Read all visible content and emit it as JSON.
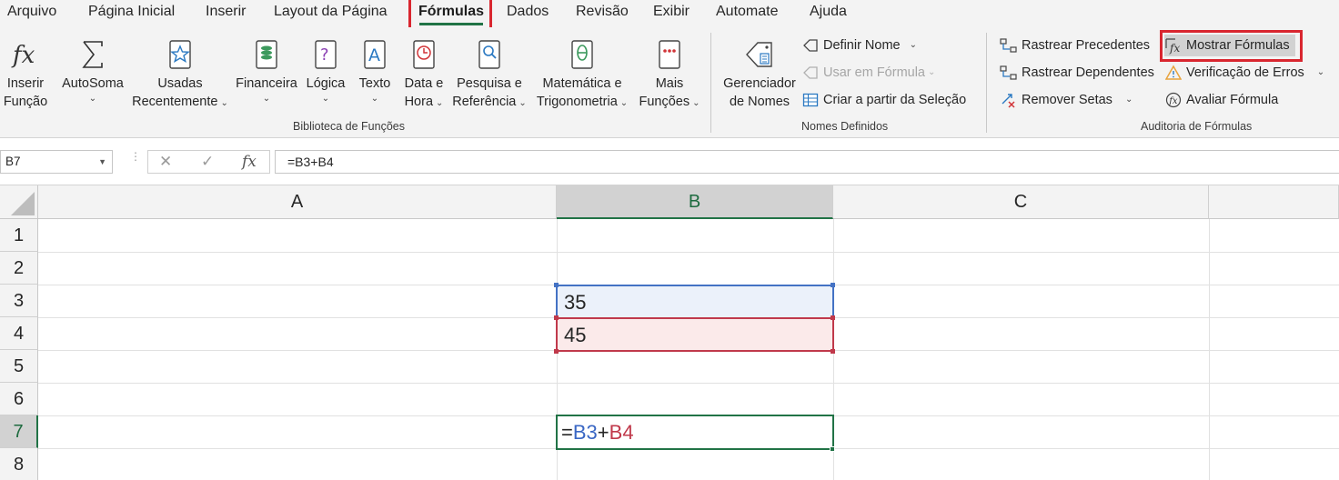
{
  "tabs": [
    {
      "label": "Arquivo"
    },
    {
      "label": "Página Inicial"
    },
    {
      "label": "Inserir"
    },
    {
      "label": "Layout da Página"
    },
    {
      "label": "Fórmulas"
    },
    {
      "label": "Dados"
    },
    {
      "label": "Revisão"
    },
    {
      "label": "Exibir"
    },
    {
      "label": "Automate"
    },
    {
      "label": "Ajuda"
    }
  ],
  "ribbon": {
    "funcs": {
      "insert_function": [
        "Inserir",
        "Função"
      ],
      "autosum": [
        "AutoSoma"
      ],
      "recent": [
        "Usadas",
        "Recentemente"
      ],
      "financial": [
        "Financeira"
      ],
      "logical": [
        "Lógica"
      ],
      "text": [
        "Texto"
      ],
      "datetime": [
        "Data e",
        "Hora"
      ],
      "lookup": [
        "Pesquisa e",
        "Referência"
      ],
      "math": [
        "Matemática e",
        "Trigonometria"
      ],
      "more": [
        "Mais",
        "Funções"
      ],
      "group_label": "Biblioteca de Funções"
    },
    "names": {
      "name_manager": [
        "Gerenciador",
        "de Nomes"
      ],
      "define_name": "Definir Nome",
      "use_in_formula": "Usar em Fórmula",
      "create_from_selection": "Criar a partir da Seleção",
      "group_label": "Nomes Definidos"
    },
    "audit": {
      "trace_precedents": "Rastrear Precedentes",
      "trace_dependents": "Rastrear Dependentes",
      "remove_arrows": "Remover Setas",
      "show_formulas": "Mostrar Fórmulas",
      "error_checking": "Verificação de Erros",
      "evaluate_formula": "Avaliar Fórmula",
      "group_label": "Auditoria de Fórmulas"
    }
  },
  "formula_bar": {
    "name_box": "B7",
    "formula": "=B3+B4"
  },
  "sheet": {
    "columns": [
      "A",
      "B",
      "C"
    ],
    "rows": [
      "1",
      "2",
      "3",
      "4",
      "5",
      "6",
      "7",
      "8"
    ],
    "cells": {
      "B3": "35",
      "B4": "45",
      "B7_parts": {
        "eq": "=",
        "ref1": "B3",
        "plus": "+",
        "ref2": "B4"
      }
    }
  },
  "colors": {
    "accent_green": "#217346",
    "highlight_red": "#d9262f",
    "ref_blue": "#4472c4",
    "ref_red": "#c0394b"
  }
}
